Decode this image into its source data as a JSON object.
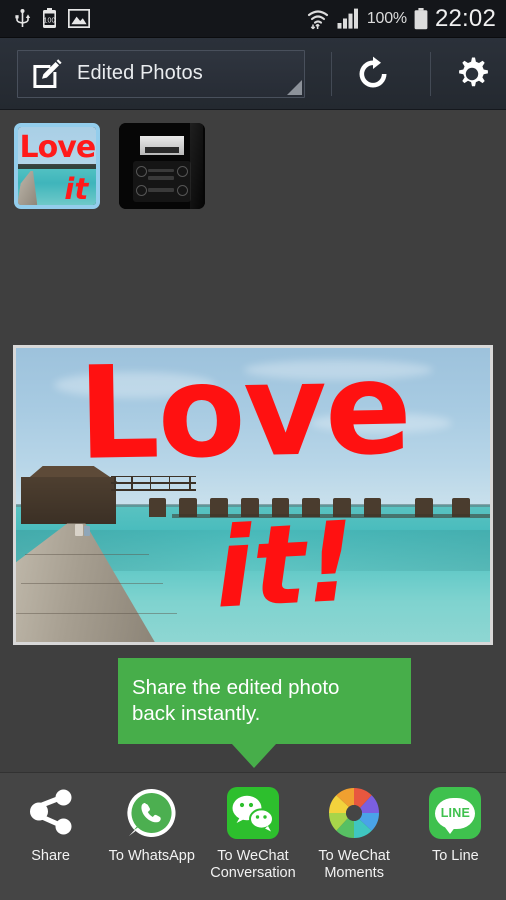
{
  "statusbar": {
    "icons": [
      "usb-icon",
      "battery-charge-icon",
      "gallery-icon",
      "wifi-icon",
      "signal-bars-icon",
      "battery-icon"
    ],
    "battery_percent": "100%",
    "time": "22:02"
  },
  "toolbar": {
    "album_label": "Edited Photos",
    "pencil_icon": "edit-pencil-icon",
    "caret_icon": "dropdown-caret-icon",
    "refresh_icon": "refresh-icon",
    "settings_icon": "gear-icon"
  },
  "thumbnails": [
    {
      "name": "love-it-beach-thumbnail",
      "selected": true,
      "overlay_line1": "Love",
      "overlay_line2": "it"
    },
    {
      "name": "car-dashboard-thumbnail",
      "selected": false,
      "overlay_line1": "",
      "overlay_line2": ""
    }
  ],
  "photo": {
    "name": "edited-photo-preview",
    "scene": "maldives-overwater-bungalows",
    "annotation_line1": "Love",
    "annotation_line2": "it!",
    "annotation_color": "#ff1111"
  },
  "tooltip": {
    "line1": "Share the edited photo",
    "line2": "back instantly.",
    "color": "#47ae4a"
  },
  "share": {
    "items": [
      {
        "label": "Share",
        "icon": "share-nodes-icon",
        "brand": "#ffffff"
      },
      {
        "label": "To WhatsApp",
        "icon": "whatsapp-icon",
        "brand": "#4caf50"
      },
      {
        "label": "To WeChat\nConversation",
        "label1": "To WeChat",
        "label2": "Conversation",
        "icon": "wechat-icon",
        "brand": "#2dbf2d"
      },
      {
        "label": "To WeChat\nMoments",
        "label1": "To WeChat",
        "label2": "Moments",
        "icon": "wechat-moments-aperture-icon",
        "brand": "#f0a030"
      },
      {
        "label": "To Line",
        "icon": "line-icon",
        "brand": "#3fc14e"
      }
    ],
    "line_badge_text": "LINE"
  },
  "colors": {
    "page_bg": "#3f3f3f",
    "statusbar_bg": "#14161a",
    "toolbar_bg": "#2b313a",
    "sharebar_bg": "#454545",
    "thumb_selected_border": "#93cdec"
  }
}
